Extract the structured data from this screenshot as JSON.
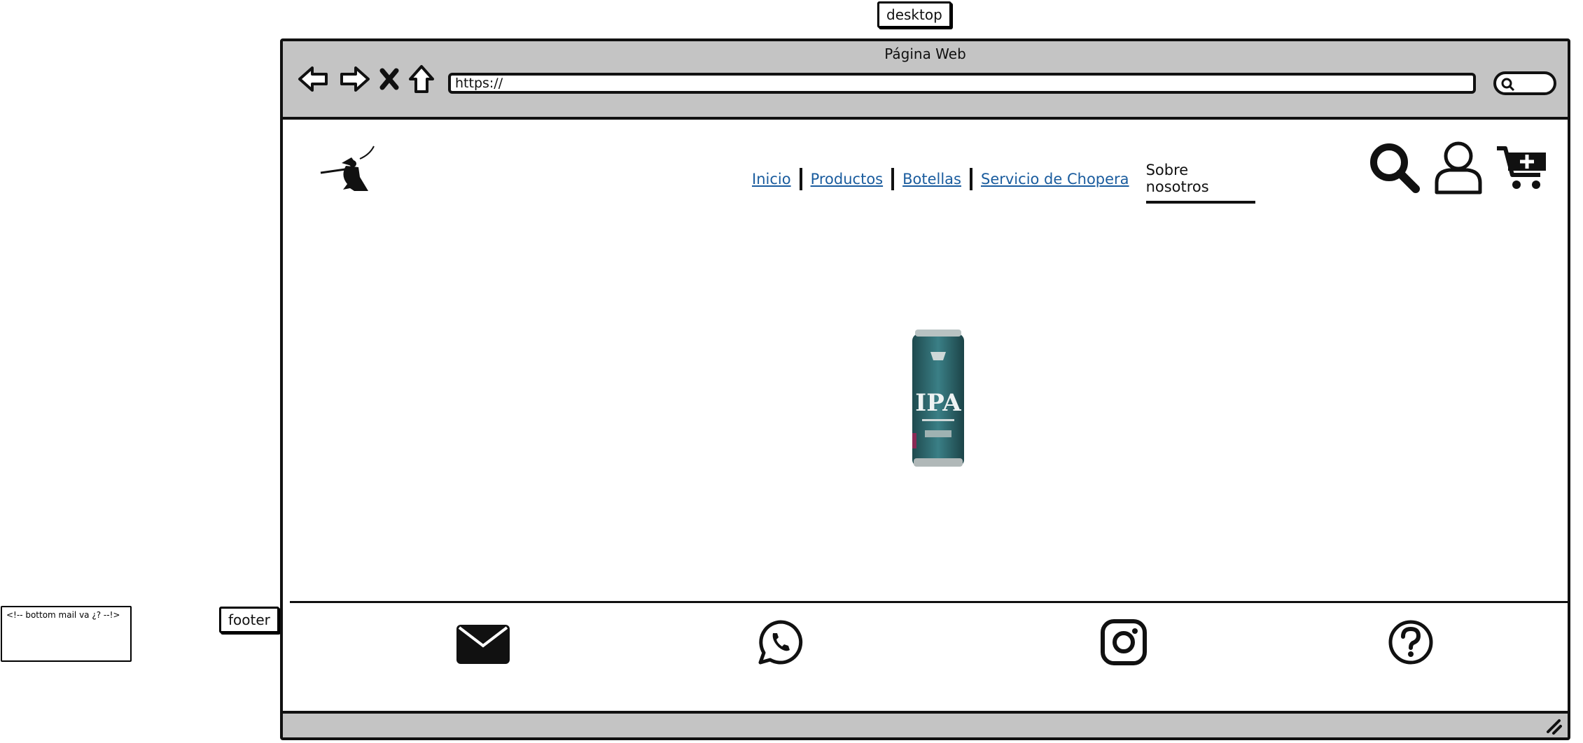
{
  "annotations": {
    "desktop_label": "desktop",
    "footer_label": "footer",
    "note": "<!-- bottom mail va ¿? --!>"
  },
  "window": {
    "title": "Página Web",
    "url": "https://"
  },
  "nav": {
    "items": [
      {
        "label": "Inicio"
      },
      {
        "label": "Productos"
      },
      {
        "label": "Botellas"
      },
      {
        "label": "Servicio de Chopera"
      }
    ],
    "active_label": "Sobre nosotros"
  },
  "icons": {
    "header": [
      "search-icon",
      "user-icon",
      "cart-add-icon"
    ],
    "footer": [
      "mail-icon",
      "whatsapp-icon",
      "instagram-icon",
      "help-icon"
    ]
  },
  "hero": {
    "product_text": "IPA",
    "brand_color": "#2f6e74"
  }
}
